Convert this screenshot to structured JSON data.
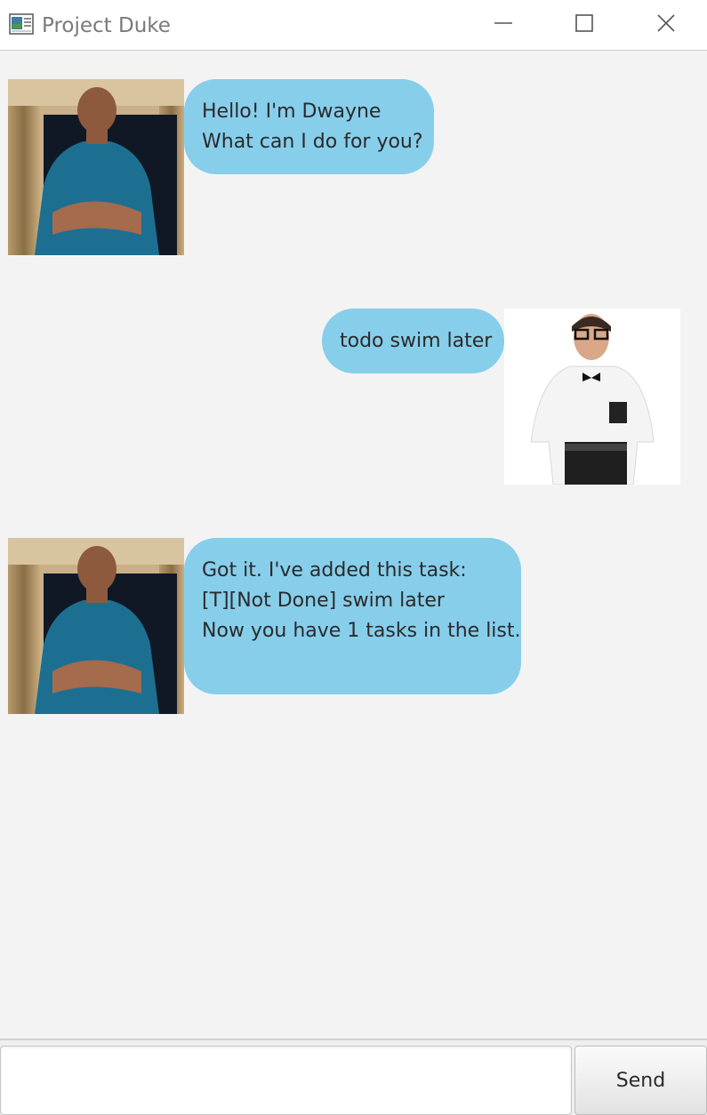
{
  "window": {
    "title": "Project Duke",
    "icon": "app-window-icon",
    "controls": {
      "minimize_icon": "minimize-icon",
      "maximize_icon": "maximize-icon",
      "close_icon": "close-icon"
    }
  },
  "chat": {
    "messages": [
      {
        "sender": "duke",
        "avatar": "duke-avatar",
        "lines": [
          "Hello! I'm Dwayne",
          "What can I do for you?"
        ]
      },
      {
        "sender": "user",
        "avatar": "user-avatar",
        "lines": [
          "todo swim later"
        ]
      },
      {
        "sender": "duke",
        "avatar": "duke-avatar",
        "lines": [
          "Got it. I've added this task:",
          "[T][Not Done] swim later",
          "Now you have 1 tasks in the list."
        ]
      }
    ]
  },
  "input": {
    "value": "",
    "placeholder": ""
  },
  "send": {
    "label": "Send"
  },
  "colors": {
    "bubble": "#87ceeb",
    "background": "#f3f3f4",
    "titlebar": "#ffffff"
  }
}
